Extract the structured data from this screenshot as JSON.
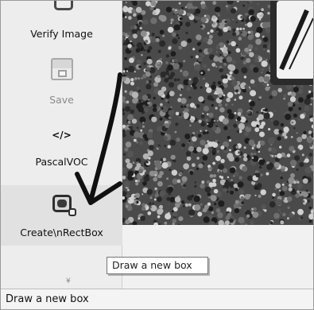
{
  "toolbar": {
    "items": [
      {
        "icon": "verify-icon",
        "label": "Verify Image",
        "enabled": true
      },
      {
        "icon": "save-icon",
        "label": "Save",
        "enabled": false
      },
      {
        "icon": "code-icon",
        "glyph": "</>",
        "label": "PascalVOC",
        "enabled": true
      },
      {
        "icon": "create-rectbox-icon",
        "label": "Create\\nRectBox",
        "enabled": true
      },
      {
        "icon": "more-icon",
        "glyph": "¥",
        "label": "",
        "enabled": true
      }
    ]
  },
  "tooltip": {
    "text": "Draw a new box"
  },
  "status_bar": {
    "text": "Draw a new box"
  },
  "colors": {
    "toolbar_bg": "#ededed",
    "canvas_dark": "#3c3c3c",
    "arrow": "#111111"
  }
}
